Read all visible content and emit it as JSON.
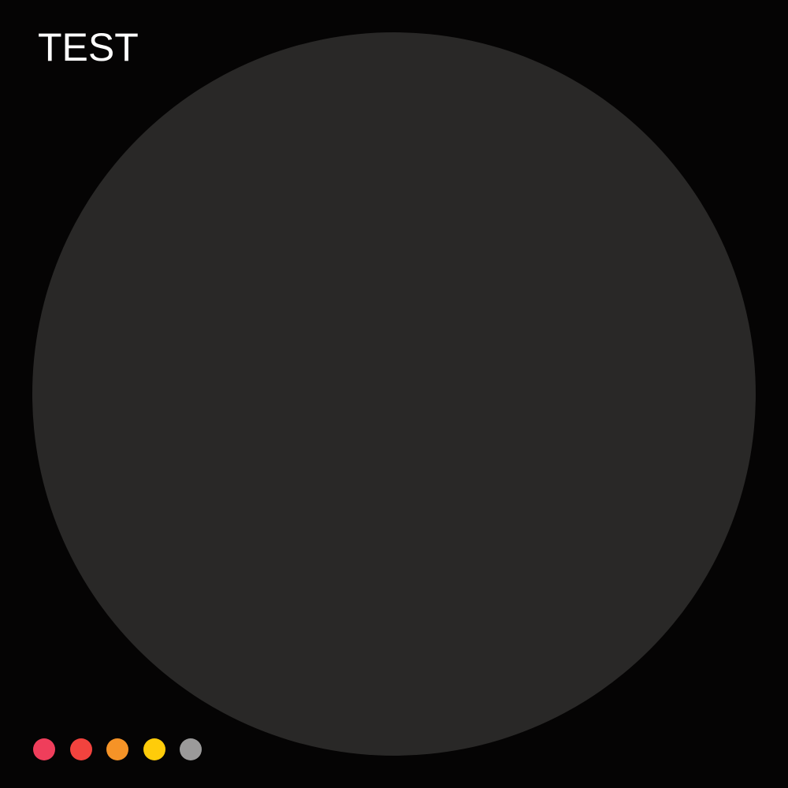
{
  "title": "TEST",
  "background_color": "#050404",
  "circle_color": "#292827",
  "title_color": "#ffffff",
  "swatches": [
    {
      "name": "pink-red",
      "color": "#EF3E5B"
    },
    {
      "name": "red",
      "color": "#F2433E"
    },
    {
      "name": "orange",
      "color": "#F59327"
    },
    {
      "name": "yellow",
      "color": "#FFCC0A"
    },
    {
      "name": "gray",
      "color": "#9B9A9A"
    }
  ]
}
